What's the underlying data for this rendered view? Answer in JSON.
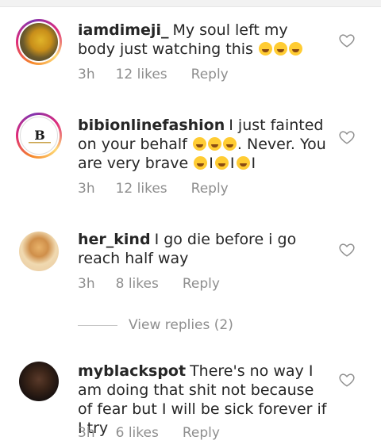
{
  "comments": [
    {
      "username": "iamdimeji_",
      "text": "My soul left my body just watching this",
      "emoji_count": 3,
      "time": "3h",
      "likes": "12 likes",
      "reply": "Reply"
    },
    {
      "username": "bibionlinefashion",
      "text_a": "I just fainted on your behalf",
      "text_b": ". Never. You are very brave",
      "separator": "I",
      "time": "3h",
      "likes": "12 likes",
      "reply": "Reply"
    },
    {
      "username": "her_kind",
      "text": "I go die before i go reach half way",
      "time": "3h",
      "likes": "8 likes",
      "reply": "Reply"
    },
    {
      "username": "myblackspot",
      "text": "There's no way I am doing that shit not because of fear but I will be sick forever if I try",
      "time": "3h",
      "likes": "6 likes",
      "reply": "Reply"
    }
  ],
  "view_replies": "View replies (2)",
  "colors": {
    "text": "#262626",
    "meta": "#8e8e8e",
    "emoji": "#ffcc33"
  }
}
